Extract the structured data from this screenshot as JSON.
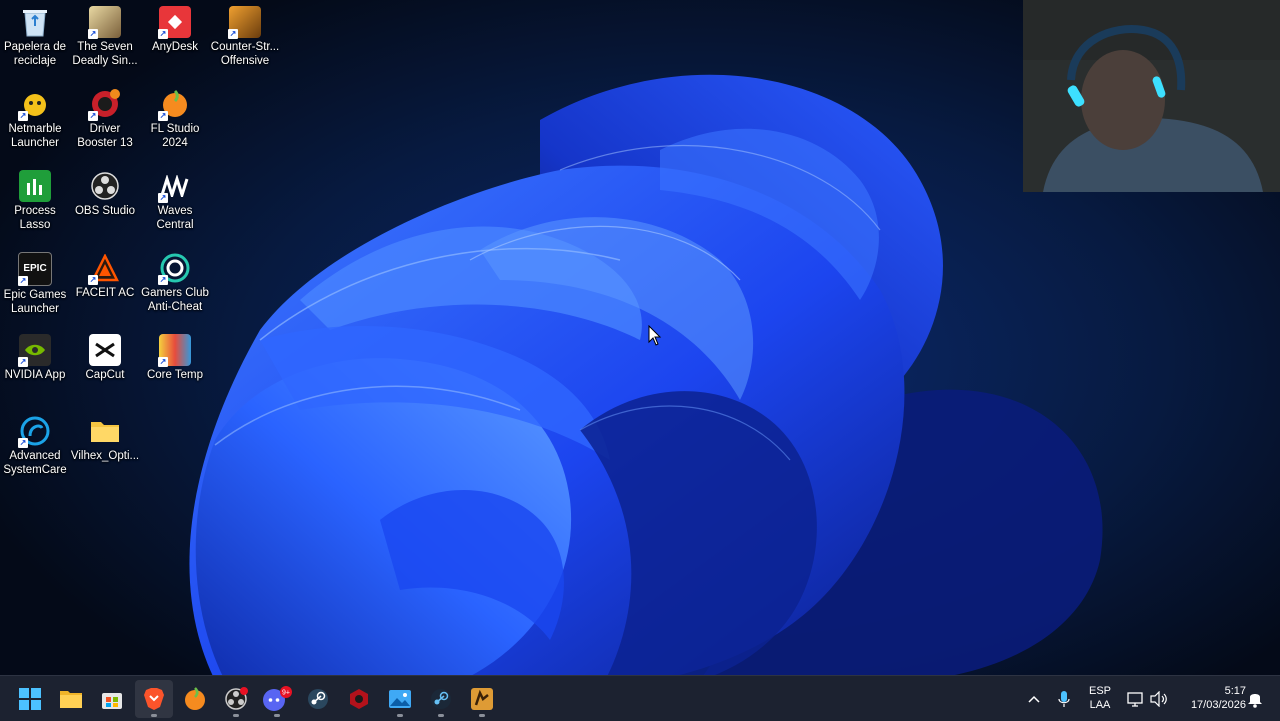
{
  "desktop": {
    "icons": [
      {
        "label": "Papelera de reciclaje",
        "icon": "recycle-bin-icon"
      },
      {
        "label": "The Seven Deadly Sin...",
        "icon": "game-icon"
      },
      {
        "label": "AnyDesk",
        "icon": "anydesk-icon"
      },
      {
        "label": "Counter-Str... Offensive",
        "icon": "counter-strike-icon"
      },
      {
        "label": "Netmarble Launcher",
        "icon": "netmarble-icon"
      },
      {
        "label": "Driver Booster 13",
        "icon": "driver-booster-icon"
      },
      {
        "label": "FL Studio 2024",
        "icon": "fl-studio-icon"
      },
      {
        "label": "Process Lasso",
        "icon": "process-lasso-icon"
      },
      {
        "label": "OBS Studio",
        "icon": "obs-icon"
      },
      {
        "label": "Waves Central",
        "icon": "waves-icon"
      },
      {
        "label": "Epic Games Launcher",
        "icon": "epic-games-icon"
      },
      {
        "label": "FACEIT AC",
        "icon": "faceit-icon"
      },
      {
        "label": "Gamers Club Anti-Cheat",
        "icon": "gamers-club-icon"
      },
      {
        "label": "NVIDIA App",
        "icon": "nvidia-icon"
      },
      {
        "label": "CapCut",
        "icon": "capcut-icon"
      },
      {
        "label": "Core Temp",
        "icon": "core-temp-icon"
      },
      {
        "label": "Advanced SystemCare",
        "icon": "advanced-systemcare-icon"
      },
      {
        "label": "Vilhex_Opti...",
        "icon": "folder-icon"
      }
    ]
  },
  "taskbar": {
    "apps": [
      {
        "name": "start",
        "icon": "windows-start-icon"
      },
      {
        "name": "file-explorer",
        "icon": "folder-icon"
      },
      {
        "name": "store",
        "icon": "store-icon"
      },
      {
        "name": "brave",
        "icon": "brave-icon"
      },
      {
        "name": "fl-studio",
        "icon": "fl-studio-icon"
      },
      {
        "name": "obs",
        "icon": "obs-icon"
      },
      {
        "name": "discord",
        "icon": "discord-icon",
        "badge": "9+"
      },
      {
        "name": "steam",
        "icon": "steam-icon"
      },
      {
        "name": "app-red",
        "icon": "red-app-icon"
      },
      {
        "name": "photos",
        "icon": "photos-icon"
      },
      {
        "name": "steam-2",
        "icon": "steam-icon"
      },
      {
        "name": "counter-strike",
        "icon": "counter-strike-icon"
      }
    ],
    "tray": {
      "language_line1": "ESP",
      "language_line2": "LAA",
      "time": "5:17",
      "date": "17/03/2026"
    }
  },
  "colors": {
    "taskbar": "#1c2230",
    "wallpaper_blue": "#1f4fff",
    "desktop_bg": "#050d1e"
  }
}
